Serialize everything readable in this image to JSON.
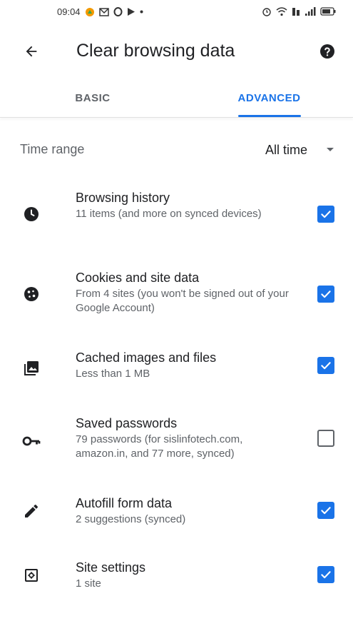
{
  "status_bar": {
    "time": "09:04"
  },
  "header": {
    "title": "Clear browsing data",
    "back_icon": "back-arrow-icon",
    "help_icon": "help-icon"
  },
  "tabs": [
    {
      "label": "BASIC",
      "active": false
    },
    {
      "label": "ADVANCED",
      "active": true
    }
  ],
  "time_range": {
    "label": "Time range",
    "value": "All time"
  },
  "items": [
    {
      "title": "Browsing history",
      "description": "11 items (and more on synced devices)",
      "checked": true,
      "icon": "clock-icon"
    },
    {
      "title": "Cookies and site data",
      "description": "From 4 sites (you won't be signed out of your Google Account)",
      "checked": true,
      "icon": "cookie-icon"
    },
    {
      "title": "Cached images and files",
      "description": "Less than 1 MB",
      "checked": true,
      "icon": "images-icon"
    },
    {
      "title": "Saved passwords",
      "description": "79 passwords (for sislinfotech.com, amazon.in, and 77 more, synced)",
      "checked": false,
      "icon": "key-icon"
    },
    {
      "title": "Autofill form data",
      "description": "2 suggestions (synced)",
      "checked": true,
      "icon": "pencil-icon"
    },
    {
      "title": "Site settings",
      "description": "1 site",
      "checked": true,
      "icon": "site-settings-icon"
    }
  ],
  "colors": {
    "accent": "#1a73e8",
    "text_primary": "#202124",
    "text_secondary": "#5f6368"
  }
}
